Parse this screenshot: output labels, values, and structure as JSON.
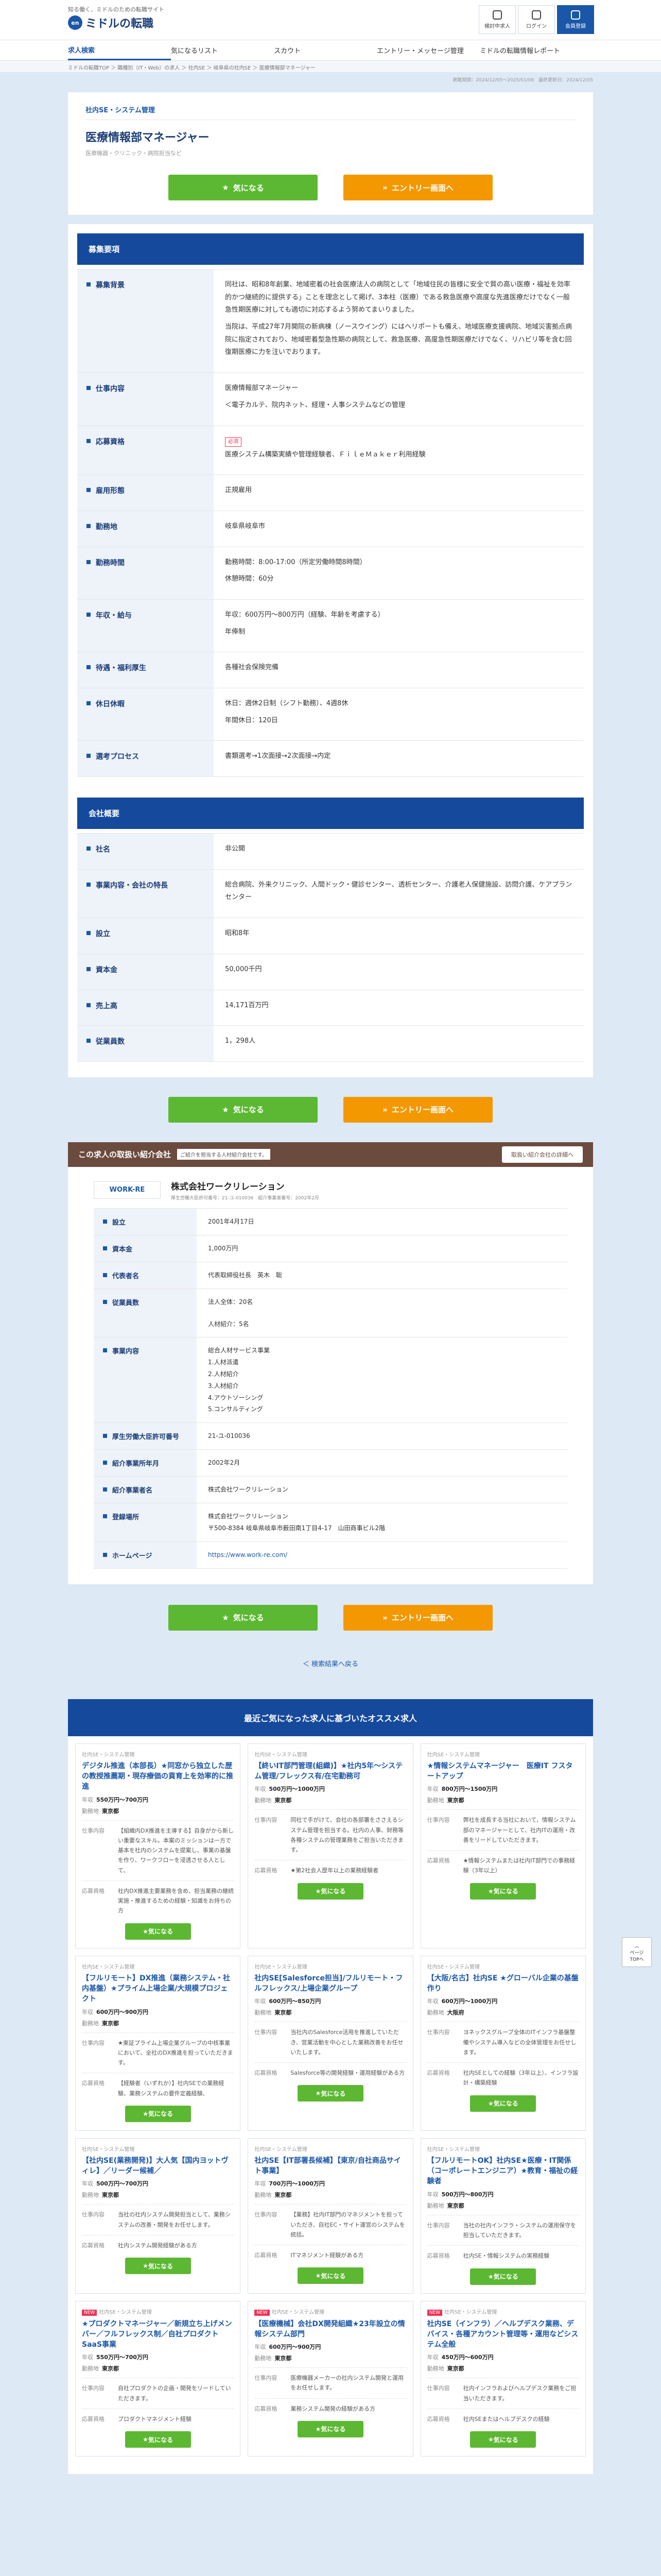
{
  "header": {
    "tagline": "知る働く、ミドルのための転職サイト",
    "logo_badge": "en",
    "logo_text": "ミドルの転職",
    "icons": [
      {
        "label": "検討中求人",
        "name": "favorites-icon"
      },
      {
        "label": "ログイン",
        "name": "login-icon"
      },
      {
        "label": "会員登録",
        "name": "register-icon"
      }
    ]
  },
  "nav": [
    "求人検索",
    "気になるリスト",
    "スカウト",
    "エントリー・メッセージ管理",
    "ミドルの転職情報レポート"
  ],
  "breadcrumb": "ミドルの転職TOP ＞ 職種別（IT・Web）の求人 ＞ 社内SE ＞ 岐阜県の社内SE ＞ 医療情報部マネージャー",
  "meta": "掲載期間：2024/12/05〜2025/01/08　最終更新日：2024/12/05",
  "job": {
    "category": "社内SE・システム管理",
    "title": "医療情報部マネージャー",
    "subtitle": "医療機器・クリニック・病院担当など"
  },
  "buttons": {
    "favorite": "気になる",
    "entry": "エントリー画面へ"
  },
  "recruit_section": "募集要項",
  "recruit": [
    {
      "label": "募集背景",
      "paras": [
        "同社は、昭和8年創業、地域密着の社会医療法人の病院として「地域住民の皆様に安全で質の高い医療・福祉を効率的かつ継続的に提供する」ことを理念として掲げ、3本柱（医療）である救急医療や高度な先進医療だけでなく一般急性期医療に対しても適切に対応するよう努めてまいりました。",
        "当院は、平成27年7月開院の新病棟（ノースウイング）にはヘリポートも備え、地域医療支援病院、地域災害拠点病院に指定されており、地域密着型急性期の病院として、救急医療、高度急性期医療だけでなく、リハビリ等を含む回復期医療に力を注いでおります。"
      ]
    },
    {
      "label": "仕事内容",
      "paras": [
        "医療情報部マネージャー",
        "＜電子カルテ、院内ネット、経理・人事システムなどの管理"
      ]
    },
    {
      "label": "応募資格",
      "tag": "必須",
      "paras": [
        "医療システム構築実績や管理経験者、ＦｉｌｅＭａｋｅｒ利用経験"
      ]
    },
    {
      "label": "雇用形態",
      "paras": [
        "正規雇用"
      ]
    },
    {
      "label": "勤務地",
      "paras": [
        "岐阜県岐阜市"
      ]
    },
    {
      "label": "勤務時間",
      "paras": [
        "勤務時間：8:00-17:00（所定労働時間8時間）",
        "休憩時間：60分"
      ]
    },
    {
      "label": "年収・給与",
      "paras": [
        "年収：600万円〜800万円（経験、年齢を考慮する）",
        "年俸制"
      ]
    },
    {
      "label": "待遇・福利厚生",
      "paras": [
        "各種社会保険完備"
      ]
    },
    {
      "label": "休日休暇",
      "paras": [
        "休日：週休2日制（シフト勤務）、4週8休",
        "年間休日：120日"
      ]
    },
    {
      "label": "選考プロセス",
      "paras": [
        "書類選考→1次面接→2次面接→内定"
      ]
    }
  ],
  "company_section": "会社概要",
  "company": [
    {
      "label": "社名",
      "value": "非公開"
    },
    {
      "label": "事業内容・会社の特長",
      "value": "総合病院、外来クリニック、人間ドック・健診センター、透析センター、介護老人保健施設、訪問介護、ケアプランセンター"
    },
    {
      "label": "設立",
      "value": "昭和8年"
    },
    {
      "label": "資本金",
      "value": "50,000千円"
    },
    {
      "label": "売上高",
      "value": "14,171百万円"
    },
    {
      "label": "従業員数",
      "value": "1，298人"
    }
  ],
  "agency": {
    "bar_title": "この求人の取扱い紹介会社",
    "bar_note": "ご紹介を担当する人材紹介会社です。",
    "bar_button": "取扱い紹介会社の詳細へ",
    "logo": "WORK-RE",
    "name": "株式会社ワークリレーション",
    "sub": "厚生労働大臣許可番号：21-ユ-010036　紹介事業者番号：2002年2月",
    "rows": [
      {
        "label": "設立",
        "lines": [
          "2001年4月17日"
        ]
      },
      {
        "label": "資本金",
        "lines": [
          "1,000万円"
        ]
      },
      {
        "label": "代表者名",
        "lines": [
          "代表取締役社長　英木　聡"
        ]
      },
      {
        "label": "従業員数",
        "lines": [
          "法人全体：20名",
          "",
          "人材紹介：5名"
        ]
      },
      {
        "label": "事業内容",
        "lines": [
          "総合人材サービス事業",
          "1.人材派遣",
          "2.人材紹介",
          "3.人材紹介",
          "4.アウトソーシング",
          "5.コンサルティング"
        ]
      },
      {
        "label": "厚生労働大臣許可番号",
        "lines": [
          "21-ユ-010036"
        ]
      },
      {
        "label": "紹介事業所年月",
        "lines": [
          "2002年2月"
        ]
      },
      {
        "label": "紹介事業者名",
        "lines": [
          "株式会社ワークリレーション"
        ]
      },
      {
        "label": "登録場所",
        "lines": [
          "株式会社ワークリレーション",
          "〒500-8384 岐阜県岐阜市薮田南1丁目4-17　山田商事ビル2階"
        ]
      },
      {
        "label": "ホームページ",
        "lines": [
          "https://www.work-re.com/"
        ]
      }
    ]
  },
  "back_link": "＜ 検索結果へ戻る",
  "page_top": "ページ\nTOPへ",
  "rec": {
    "title": "最近ご気になった求人に基づいたオススメ求人",
    "cards": [
      {
        "cat": "社内SE・システム管理",
        "badge": "",
        "title": "デジタル推進（本部長）★同窓から独立した歴の教授推薦期・現存療価の貢育上を効率的に推進",
        "salary": "550万円〜700万円",
        "place": "東京都",
        "work": "【組織内DX推進を主導する】自身がから新しい重要なスキル。本案のミッションは一方で基本を社内のシステムを提案し、事業の基盤を作り、ワークフローを浸透させる人として、",
        "cond": "社内DX推進主要業務を含め、担当業務の継続実施・推進するための経験・知識をお持ちの方"
      },
      {
        "cat": "社内SE・システム管理",
        "badge": "",
        "title": "【終いIT部門管理(組織)】★社内5年～システム管理/フレックス有/在宅勤務可",
        "salary": "500万円〜1000万円",
        "place": "東京都",
        "work": "同社で手がけて、会社の各部署をささえるシステム管理を担当する。社内の人事、財務等各種システムの管理業務をご担当いただきます。",
        "cond": "★第2社会人歴年以上の業務経験者"
      },
      {
        "cat": "社内SE・システム管理",
        "badge": "",
        "title": "★情報システムマネージャー　医療IT フスタートアップ",
        "salary": "800万円〜1500万円",
        "place": "東京都",
        "work": "弊社を成長する当社において、情報システム部のマネージャーとして、社内ITの運用・改善をリードしていただきます。",
        "cond": "★情報システムまたは社内IT部門での事務経験（3年以上）"
      },
      {
        "cat": "社内SE・システム管理",
        "badge": "",
        "title": "【フルリモート】DX推進（業務システム・社内基盤）★プライム上場企業/大規模プロジェクト",
        "salary": "600万円〜900万円",
        "place": "東京都",
        "work": "★東証プライム上場企業グループの中核事業において、全社のDX推進を担っていただきます。",
        "cond": "【経験者（いずれか）】社内SEでの業務経験、業務システムの要件定義経験、"
      },
      {
        "cat": "社内SE・システム管理",
        "badge": "",
        "title": "社内SE[Salesforce担当]/フルリモート・フルフレックス/上場企業グループ",
        "salary": "600万円〜850万円",
        "place": "東京都",
        "work": "当社内のSalesforce活用を推進していただき、営業活動を中心とした業務改善をお任せいたします。",
        "cond": "Salesforce等の開発経験・運用経験がある方"
      },
      {
        "cat": "社内SE・システム管理",
        "badge": "",
        "title": "【大阪/名古】社内SE ★グローバル企業の基盤作り",
        "salary": "600万円〜1000万円",
        "place": "大阪府",
        "work": "ヨネックスグループ全体のITインフラ基盤整備やシステム導入などの全体管理をお任せします。",
        "cond": "社内SEとしての経験（3年以上）、インフラ設計・構築経験"
      },
      {
        "cat": "社内SE・システム管理",
        "badge": "",
        "title": "【社内SE(業務開発)】大人気【国内ヨットヴィレ】／リーダー候補／",
        "salary": "500万円〜700万円",
        "place": "東京都",
        "work": "当社の社内システム開発担当として、業務システムの改善・開発をお任せします。",
        "cond": "社内システム開発経験がある方"
      },
      {
        "cat": "社内SE・システム管理",
        "badge": "",
        "title": "社内SE【IT部署長候補】【東京/自社商品サイト事業】",
        "salary": "700万円〜1000万円",
        "place": "東京都",
        "work": "【業務】社内IT部門のマネジメントを担っていただき、自社EC・サイト運営のシステムを統括。",
        "cond": "ITマネジメント経験がある方"
      },
      {
        "cat": "社内SE・システム管理",
        "badge": "",
        "title": "【フルリモートOK】社内SE★医療・IT関係（コーポレートエンジニア）★教育・福祉の経験者",
        "salary": "500万円〜800万円",
        "place": "東京都",
        "work": "当社の社内インフラ・システムの運用保守を担当していただきます。",
        "cond": "社内SE・情報システムの実務経験"
      },
      {
        "cat": "社内SE・システム管理",
        "badge": "NEW",
        "title": "★プロダクトマネージャー／新規立ち上げメンバー／フルフレックス制／自社プロダクトSaaS事業",
        "salary": "550万円〜700万円",
        "place": "東京都",
        "work": "自社プロダクトの企画・開発をリードしていただきます。",
        "cond": "プロダクトマネジメント経験"
      },
      {
        "cat": "社内SE・システム管理",
        "badge": "NEW",
        "title": "【医療機械】会社DX開発組織★23年設立の情報システム部門",
        "salary": "600万円〜900万円",
        "place": "東京都",
        "work": "医療機器メーカーの社内システム開発と運用をお任せします。",
        "cond": "業務システム開発の経験がある方"
      },
      {
        "cat": "社内SE・システム管理",
        "badge": "NEW",
        "title": "社内SE（インフラ）／ヘルプデスク業務、デバイス・各種アカウント管理等・運用などシステム全般",
        "salary": "450万円〜600万円",
        "place": "東京都",
        "work": "社内インフラおよびヘルプデスク業務をご担当いただきます。",
        "cond": "社内SEまたはヘルプデスクの経験"
      }
    ],
    "labels": {
      "salary": "年収",
      "place": "勤務地",
      "work": "仕事内容",
      "cond": "応募資格",
      "button": "気になる"
    }
  }
}
